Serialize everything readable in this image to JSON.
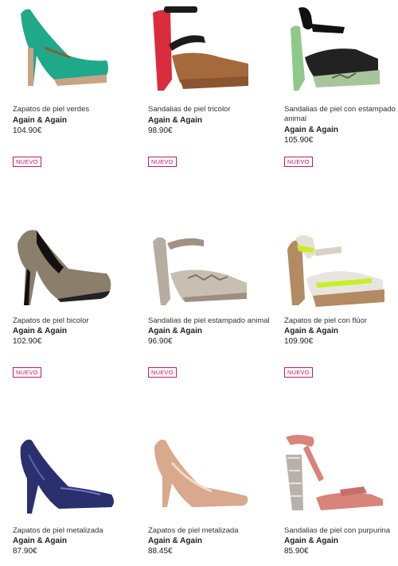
{
  "products": [
    {
      "name": "Zapatos de piel verdes",
      "brand": "Again & Again",
      "price": "104.90€",
      "badge": "NUEVO",
      "icon": "green-pump-shoe-icon"
    },
    {
      "name": "Sandalias de piel tricolor",
      "brand": "Again & Again",
      "price": "98.90€",
      "badge": "NUEVO",
      "icon": "tricolor-sandal-icon"
    },
    {
      "name": "Sandalias de piel con estampado animal",
      "brand": "Again & Again",
      "price": "105.90€",
      "badge": "NUEVO",
      "icon": "animal-print-sandal-icon"
    },
    {
      "name": "Zapatos de piel bicolor",
      "brand": "Again & Again",
      "price": "102.90€",
      "badge": "NUEVO",
      "icon": "bicolor-pump-icon"
    },
    {
      "name": "Sandalias de piel estampado animal",
      "brand": "Again & Again",
      "price": "96.90€",
      "badge": "NUEVO",
      "icon": "snake-print-sandal-icon"
    },
    {
      "name": "Zapatos de piel con flúor",
      "brand": "Again & Again",
      "price": "109.90€",
      "badge": "NUEVO",
      "icon": "fluor-platform-shoe-icon"
    },
    {
      "name": "Zapatos de piel metalizada",
      "brand": "Again & Again",
      "price": "87.90€",
      "icon": "metallic-blue-pump-icon"
    },
    {
      "name": "Zapatos de piel metalizada",
      "brand": "Again & Again",
      "price": "88.45€",
      "icon": "metallic-gold-pump-icon"
    },
    {
      "name": "Sandalias de piel con purpurina",
      "brand": "Again & Again",
      "price": "85.90€",
      "icon": "glitter-sandal-icon"
    }
  ],
  "colors": {
    "badge": "#c2186b"
  }
}
